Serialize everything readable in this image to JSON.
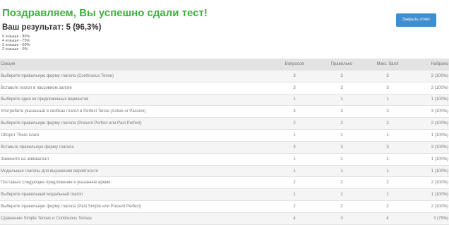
{
  "header": {
    "title": "Поздравляем, Вы успешно сдали тест!",
    "result": "Ваш результат: 5 (96,3%)",
    "scale": [
      "5 и выше - 85%",
      "4 и выше - 75%",
      "3 и выше - 60%",
      "2 и выше - 0%"
    ],
    "close_label": "Закрыть отчет"
  },
  "colors": {
    "title": "#3cb13c",
    "button": "#3e8ed0"
  },
  "table": {
    "columns": [
      "Секция",
      "Вопросов",
      "Правильно",
      "Макс. балл",
      "Набрано"
    ],
    "rows": [
      [
        "Выберите правильную форму глагола (Continuous Tense)",
        "3",
        "3",
        "3",
        "3 (100%)"
      ],
      [
        "Вставьте глагол в пассивном залоге",
        "3",
        "3",
        "3",
        "3 (100%)"
      ],
      [
        "Выберите один из предложенных вариантов",
        "1",
        "1",
        "1",
        "1 (100%)"
      ],
      [
        "Употребите указанный в скобках глагол в Perfect Tense (Active or Passive)",
        "3",
        "3",
        "3",
        "3 (100%)"
      ],
      [
        "Выберите правильную форму глагола (Present Perfect или Past Perfect)",
        "2",
        "2",
        "2",
        "2 (100%)"
      ],
      [
        "Оборот There is/are",
        "1",
        "1",
        "1",
        "1 (100%)"
      ],
      [
        "Вставьте правильную форму глагола",
        "3",
        "3",
        "3",
        "3 (100%)"
      ],
      [
        "Замените на эквивалент",
        "1",
        "1",
        "1",
        "1 (100%)"
      ],
      [
        "Модальные глаголы для выражения вероятности",
        "1",
        "1",
        "1",
        "1 (100%)"
      ],
      [
        "Поставьте следующее предложение в указанное время:",
        "2",
        "2",
        "2",
        "2 (100%)"
      ],
      [
        "Выберите правильный модальный глагол",
        "1",
        "1",
        "1",
        "1 (100%)"
      ],
      [
        "Выберите правильную форму глагола (Past Simple или Present Perfect)",
        "2",
        "2",
        "2",
        "2 (100%)"
      ],
      [
        "Сравнение Simple Tenses и Continuous Tenses",
        "4",
        "3",
        "4",
        "3 (75%)"
      ]
    ]
  }
}
